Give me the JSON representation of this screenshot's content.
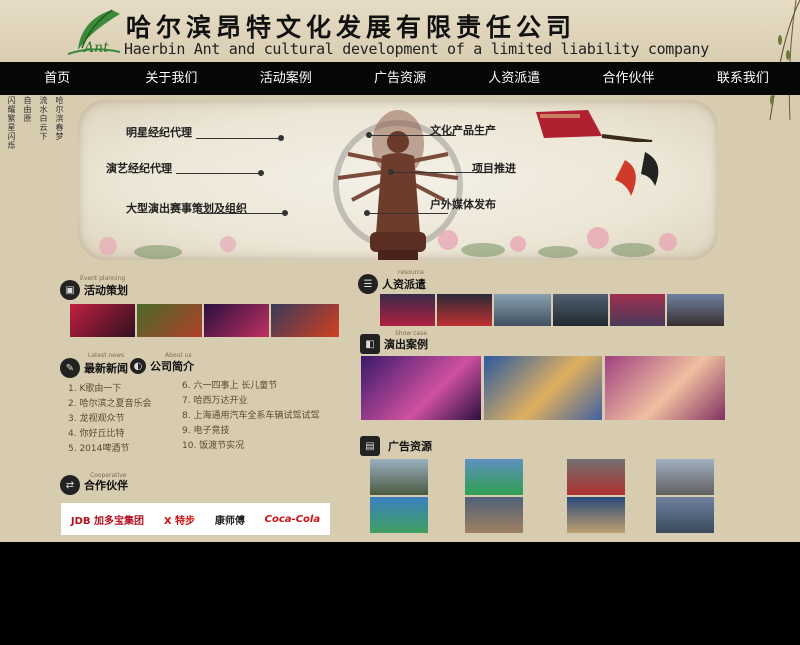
{
  "header": {
    "title_cn": "哈尔滨昂特文化发展有限责任公司",
    "title_en": "Haerbin Ant and cultural development of a limited liability company",
    "logo_text": "Ant"
  },
  "nav": [
    "首页",
    "关于我们",
    "活动案例",
    "广告资源",
    "人资派遣",
    "合作伙伴",
    "联系我们"
  ],
  "banner": {
    "left_labels": [
      "明星经纪代理",
      "演艺经纪代理",
      "大型演出赛事策划及组织"
    ],
    "right_labels": [
      "文化产品生产",
      "项目推进",
      "户外媒体发布"
    ],
    "vertical_left": [
      "闪耀繁星闪烁",
      "自由原"
    ],
    "vertical_right": [
      "流水白云下",
      "哈尔滨春梦"
    ]
  },
  "sections": {
    "event": {
      "sub": "Event planning",
      "title": "活动策划"
    },
    "hr": {
      "sub": "resource",
      "title": "人资派遣"
    },
    "show": {
      "sub": "Show case",
      "title": "演出案例"
    },
    "news": {
      "sub": "Latest news",
      "title": "最新新闻"
    },
    "about": {
      "sub": "About us",
      "title": "公司简介"
    },
    "ads": {
      "title": "广告资源"
    },
    "partner": {
      "sub": "Cooperative",
      "title": "合作伙伴"
    }
  },
  "news_left": [
    "1. K歌由一下",
    "2. 哈尔滨之夏音乐会",
    "3. 龙视观众节",
    "4. 你好丘比特",
    "5. 2014啤酒节"
  ],
  "news_right": [
    "6. 六一四事上 长儿童节",
    "7. 哈西万达开业",
    "8. 上海通用汽车全系车辆试驾试驾",
    "9. 电子竞技",
    "10. 饭渡节实况"
  ],
  "partners": [
    "JDB 加多宝集团",
    "X 特步",
    "康师傅",
    "Coca-Cola"
  ],
  "colors": {
    "nav_bg": "#070707",
    "page_bg": "#d8ccb0",
    "accent_red": "#c0202a"
  }
}
